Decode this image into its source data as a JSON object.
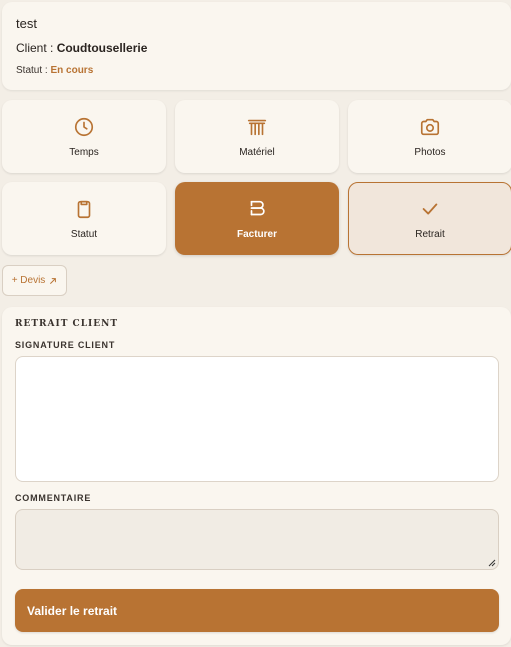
{
  "job": {
    "title": "test",
    "client_prefix": "Client : ",
    "client_name": "Coudtousellerie",
    "status_prefix": "Statut : ",
    "status_value": "En cours"
  },
  "tiles": [
    {
      "label": "Temps",
      "icon": "clock-icon"
    },
    {
      "label": "Matériel",
      "icon": "columns-icon"
    },
    {
      "label": "Photos",
      "icon": "camera-icon"
    },
    {
      "label": "Statut",
      "icon": "clipboard-icon"
    },
    {
      "label": "Facturer",
      "icon": "invoice-icon",
      "state": "active"
    },
    {
      "label": "Retrait",
      "icon": "check-icon",
      "state": "selected"
    }
  ],
  "devis_button": {
    "label": "+ Devis",
    "icon": "external-link-icon"
  },
  "retrait_panel": {
    "title": "RETRAIT CLIENT",
    "signature_label": "SIGNATURE CLIENT",
    "comment_label": "COMMENTAIRE",
    "comment_value": "",
    "submit_label": "Valider le retrait"
  },
  "colors": {
    "accent": "#b87333",
    "background": "#f3eee6",
    "card": "#faf6ef",
    "selected_tile": "#f1e6db"
  }
}
